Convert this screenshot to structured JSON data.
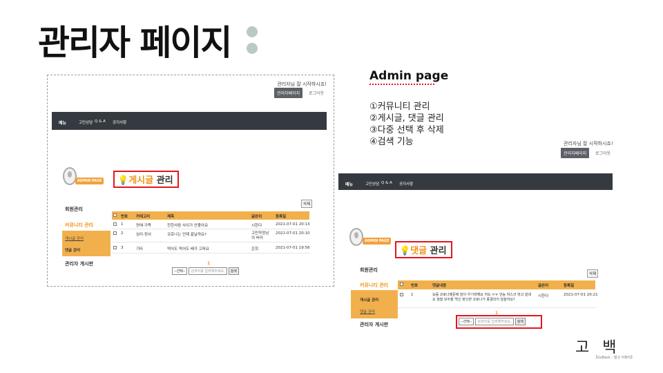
{
  "slide": {
    "title": "관리자 페이지",
    "admin_page": "Admin page",
    "features": [
      "①커뮤니티 관리",
      "②게시글, 댓글 관리",
      "③다중 선택 후 삭제",
      "④검색 기능"
    ],
    "corner_title": "고 백",
    "corner_sub": "【GoBack : 말고 아파이】"
  },
  "colors": {
    "accent_orange": "#f2b04c",
    "highlight_red": "#e4151c",
    "menubar": "#353a40"
  },
  "left_panel": {
    "greeting": "관리자님 잘 시작하시죠!",
    "admin_button": "관리자페이지",
    "logout": "로그아웃",
    "menu_label": "메뉴",
    "menu_links": [
      "고민상담",
      "Q & A",
      "공지사항"
    ],
    "admin_badge": "ADMIN PAGE",
    "section_icon": "lightbulb-icon",
    "section_highlight": "게시글",
    "section_rest": " 관리",
    "sidebar": {
      "member": "회원관리",
      "community": "커뮤니티 관리",
      "posts": "게시글 관리",
      "comments": "댓글 관리",
      "board": "관리자 게시판"
    },
    "delete_button": "삭제",
    "table": {
      "headers": [
        "번호",
        "카테고리",
        "제목",
        "글쓴이",
        "등록일"
      ],
      "rows": [
        [
          "1",
          "연애·가족",
          "친한사람 사이가 안좋아요",
          "시한다",
          "2021-07-01 20:13"
        ],
        [
          "2",
          "심리·정서",
          "코로나는 언제 끝날까요?",
          "고민작정남의 버러",
          "2021-07-01 20:10"
        ],
        [
          "3",
          "기타",
          "먹어도 먹어도 배가 고파요",
          "은희",
          "2021-07-01 19:56"
        ]
      ]
    },
    "page_number": "1",
    "search": {
      "select": "--선택--",
      "placeholder": "검색어를 입력해주세요.",
      "button": "검색"
    }
  },
  "right_panel": {
    "greeting": "관리자님 잘 시작하시죠!",
    "admin_button": "관리자페이지",
    "logout": "로그아웃",
    "menu_label": "메뉴",
    "menu_links": [
      "고민상담",
      "Q & A",
      "공지사항"
    ],
    "admin_badge": "ADMIN PAGE",
    "section_icon": "lightbulb-icon",
    "section_highlight": "댓글",
    "section_rest": " 관리",
    "sidebar": {
      "member": "회원관리",
      "community": "커뮤니티 관리",
      "posts": "게시글 관리",
      "comments": "댓글 관리",
      "board": "관리자 게시판"
    },
    "delete_button": "삭제",
    "table": {
      "headers": [
        "번호",
        "댓글내용",
        "글쓴이",
        "등록일"
      ],
      "rows": [
        [
          "1",
          "요즘 코로나때문에 많이 우기력해요 저도 ㅠㅠ 언능 마스크 벗고 살네요 정말 모두들 백신 맞으면 코로나가 종결되지 않을까요?",
          "시한다",
          "2021-07-01 20:21"
        ]
      ]
    },
    "page_number": "1",
    "search": {
      "select": "--선택--",
      "placeholder": "검색어를 입력해주세요.",
      "button": "검색"
    }
  }
}
